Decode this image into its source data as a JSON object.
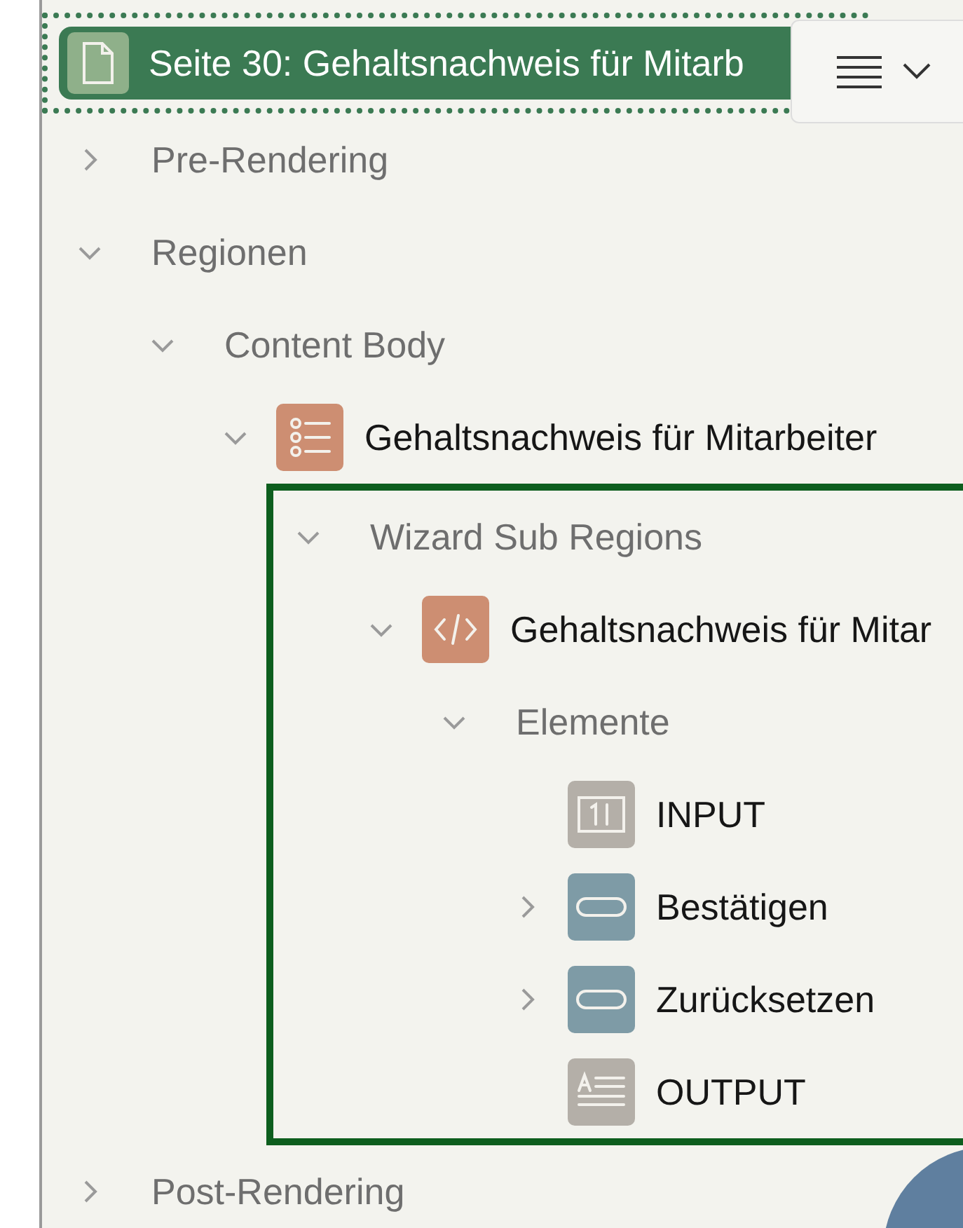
{
  "header": {
    "title": "Seite 30: Gehaltsnachweis für Mitarb",
    "kind": "page",
    "selected": true
  },
  "tree": [
    {
      "label": "Pre-Rendering",
      "kind": "group",
      "expanded": false
    },
    {
      "label": "Regionen",
      "kind": "group",
      "expanded": true,
      "children": [
        {
          "label": "Content Body",
          "kind": "group",
          "expanded": true,
          "children": [
            {
              "label": "Gehaltsnachweis für Mitarbeiter",
              "kind": "list",
              "expanded": true,
              "children": [
                {
                  "label": "Wizard Sub Regions",
                  "kind": "group",
                  "expanded": true,
                  "highlighted": true,
                  "children": [
                    {
                      "label": "Gehaltsnachweis für Mitar",
                      "kind": "code",
                      "expanded": true,
                      "children": [
                        {
                          "label": "Elemente",
                          "kind": "group",
                          "expanded": true,
                          "children": [
                            {
                              "label": "INPUT",
                              "kind": "input"
                            },
                            {
                              "label": "Bestätigen",
                              "kind": "button",
                              "expanded": false
                            },
                            {
                              "label": "Zurücksetzen",
                              "kind": "button",
                              "expanded": false
                            },
                            {
                              "label": "OUTPUT",
                              "kind": "output"
                            }
                          ]
                        }
                      ]
                    }
                  ]
                }
              ]
            }
          ]
        }
      ]
    },
    {
      "label": "Post-Rendering",
      "kind": "group",
      "expanded": false
    }
  ]
}
